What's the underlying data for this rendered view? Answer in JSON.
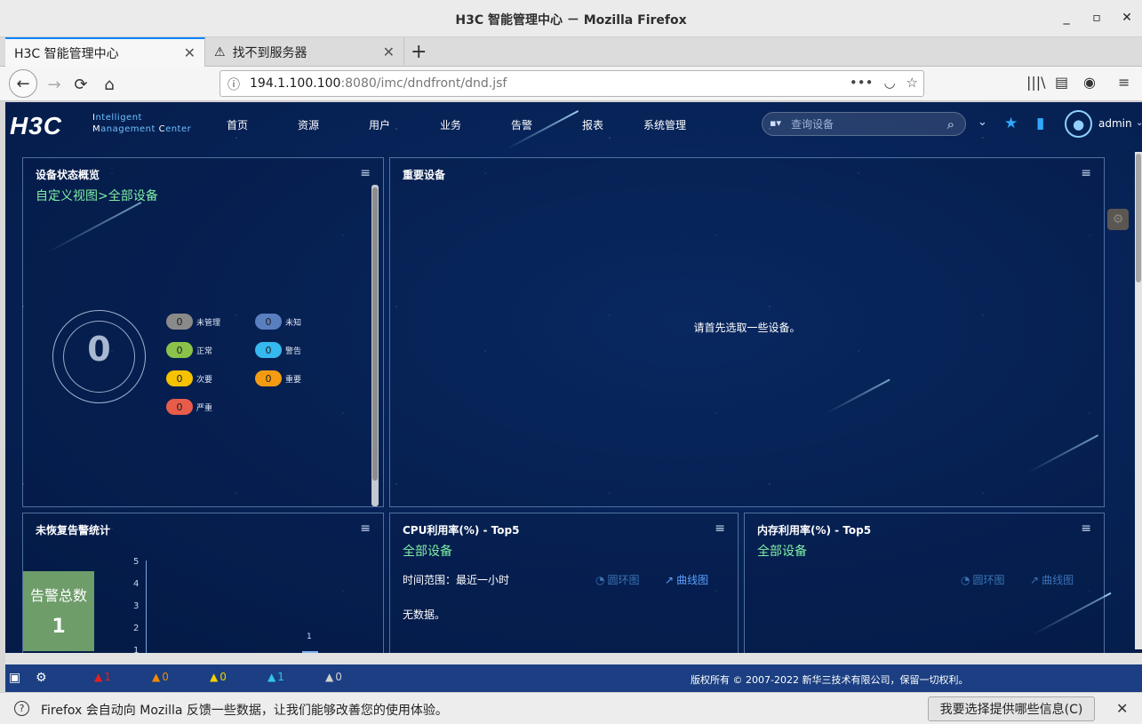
{
  "window": {
    "title": "H3C 智能管理中心 － Mozilla Firefox",
    "min": "_",
    "max": "▫",
    "close": "✕"
  },
  "tabs": [
    {
      "label": "H3C 智能管理中心",
      "close": "✕"
    },
    {
      "label": "找不到服务器",
      "icon": "⚠",
      "close": "✕"
    }
  ],
  "newtab": "+",
  "nav": {
    "back": "←",
    "forward": "→",
    "reload": "⟳",
    "home": "⌂",
    "url_host": "194.1.100.100",
    "url_rest": ":8080/imc/dndfront/dnd.jsf",
    "page_actions": "•••",
    "pocket": "◡",
    "bookmark_star": "☆",
    "library": "|||\\",
    "sidebar": "▤",
    "account": "◉",
    "menu": "≡"
  },
  "app": {
    "logo": "H3C",
    "logo_line1_rest": "ntelligent",
    "logo_line2_rest": "anagement",
    "logo_line2_end": "enter",
    "logo_I": "I",
    "logo_M": "M",
    "logo_C": "C",
    "menu": [
      "首页",
      "资源",
      "用户",
      "业务",
      "告警",
      "报表",
      "系统管理"
    ],
    "search_placeholder": "查询设备",
    "search_dropdown": "▪▾",
    "search_icon": "⌕",
    "user": "admin",
    "user_caret": "⌄"
  },
  "panels": {
    "device_status": {
      "title": "设备状态概览",
      "subtitle": "自定义视图>全部设备",
      "total": "0",
      "stats": [
        {
          "count": "0",
          "label": "未管理",
          "color": "#8a8a8a"
        },
        {
          "count": "0",
          "label": "未知",
          "color": "#5a7fc0"
        },
        {
          "count": "0",
          "label": "正常",
          "color": "#8bc34a"
        },
        {
          "count": "0",
          "label": "警告",
          "color": "#36b9ef"
        },
        {
          "count": "0",
          "label": "次要",
          "color": "#f6c100"
        },
        {
          "count": "0",
          "label": "重要",
          "color": "#f39c12"
        },
        {
          "count": "0",
          "label": "严重",
          "color": "#e85c4a"
        }
      ]
    },
    "important": {
      "title": "重要设备",
      "message": "请首先选取一些设备。"
    },
    "alarms": {
      "title": "未恢复告警统计",
      "total_label": "告警总数",
      "total": "1",
      "yticks": [
        "5",
        "4",
        "3",
        "2",
        "1"
      ],
      "bar_value": "1"
    },
    "cpu": {
      "title": "CPU利用率(%) - Top5",
      "subtitle": "全部设备",
      "range": "时间范围：最近一小时",
      "ring": "圆环图",
      "line": "曲线图",
      "nodata": "无数据。"
    },
    "mem": {
      "title": "内存利用率(%) - Top5",
      "subtitle": "全部设备",
      "ring": "圆环图",
      "line": "曲线图"
    }
  },
  "statusbar": {
    "counts": [
      {
        "value": "1",
        "color": "#e62020"
      },
      {
        "value": "0",
        "color": "#f08a00"
      },
      {
        "value": "0",
        "color": "#f2d000"
      },
      {
        "value": "1",
        "color": "#2fc6f0"
      },
      {
        "value": "0",
        "color": "#d0d0d0"
      }
    ],
    "copyright": "版权所有 © 2007-2022 新华三技术有限公司，保留一切权利。"
  },
  "notification": {
    "message": "Firefox 会自动向 Mozilla 反馈一些数据，让我们能够改善您的使用体验。",
    "button": "我要选择提供哪些信息(C)",
    "close": "✕"
  }
}
